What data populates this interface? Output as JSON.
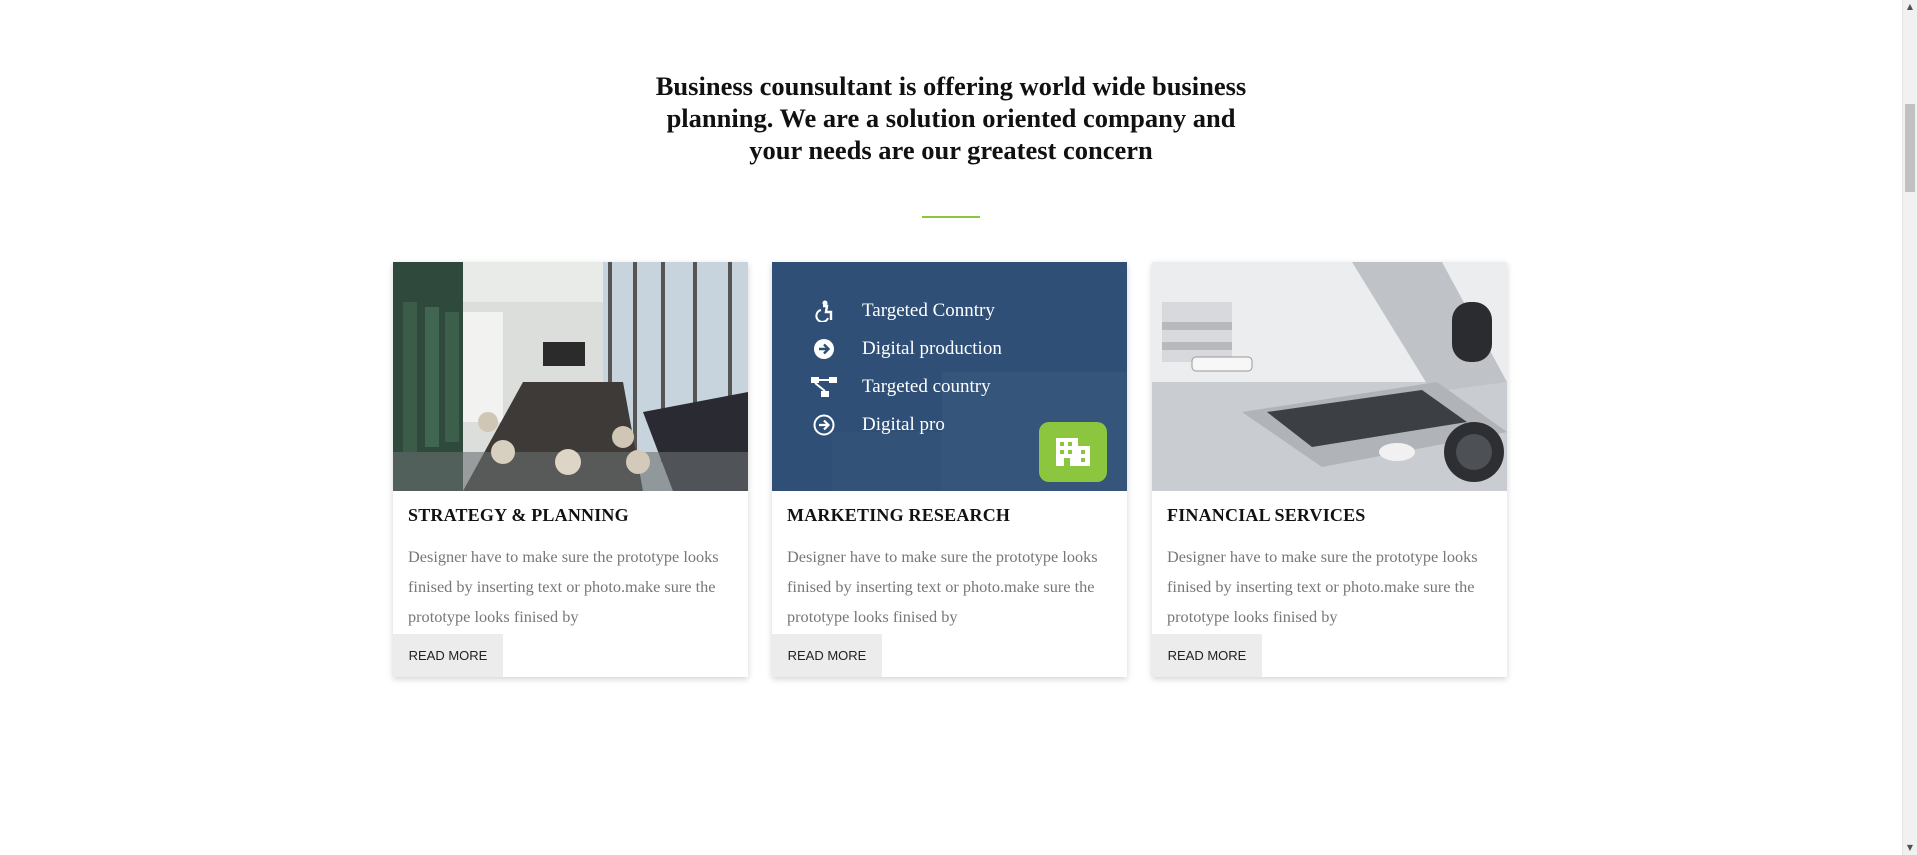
{
  "intro": {
    "headline": "Business counsultant is offering world wide business planning. We are a solution oriented company and your needs are our greatest concern",
    "accent_color": "#8cc63f"
  },
  "cards": [
    {
      "title": "STRATEGY & PLANNING",
      "description": "Designer have to make sure the prototype looks finised by inserting text or photo.make sure the prototype looks finised by",
      "read_more": "READ MORE",
      "image": "conference-room-photo"
    },
    {
      "title": "MARKETING RESEARCH",
      "description": "Designer have to make sure the prototype looks finised by inserting text or photo.make sure the prototype looks finised by",
      "read_more": "READ MORE",
      "panel_color": "#2f4f76",
      "list": [
        {
          "icon": "accessibility-icon",
          "label": "Targeted Conntry"
        },
        {
          "icon": "arrow-circle-right-icon",
          "label": "Digital production"
        },
        {
          "icon": "sitemap-icon",
          "label": "Targeted country"
        },
        {
          "icon": "arrow-circle-right-outline-icon",
          "label": "Digital pro"
        }
      ],
      "badge_icon": "building-icon"
    },
    {
      "title": "FINANCIAL SERVICES",
      "description": "Designer have to make sure the prototype looks finised by inserting text or photo.make sure the prototype looks finised by",
      "read_more": "READ MORE",
      "image": "laptop-desk-photo"
    }
  ],
  "scrollbar": {
    "up_arrow": "▲",
    "down_arrow": "▼"
  }
}
